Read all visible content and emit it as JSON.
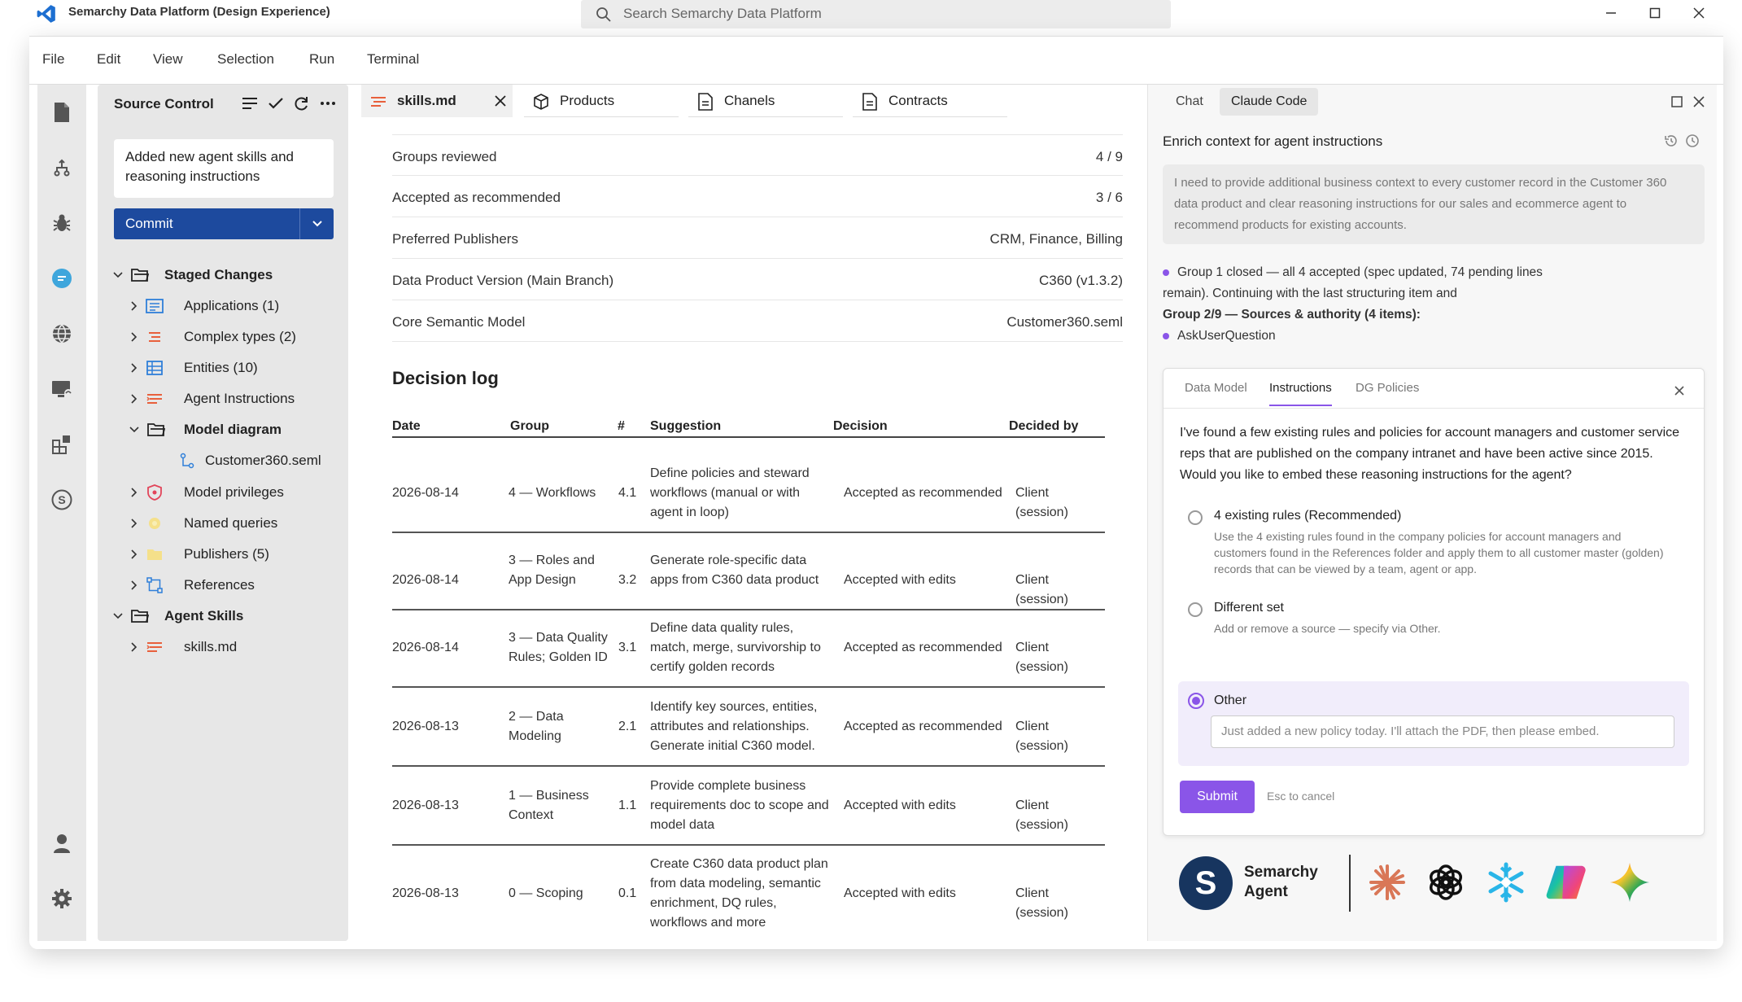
{
  "window": {
    "title": "Semarchy Data Platform (Design Experience)",
    "search_placeholder": "Search Semarchy Data Platform"
  },
  "menu": [
    "File",
    "Edit",
    "View",
    "Selection",
    "Run",
    "Terminal"
  ],
  "activity_icons": [
    "file-icon",
    "source-control-icon",
    "bug-icon",
    "chat-icon",
    "globe-icon",
    "remote-icon",
    "extensions-icon",
    "semarchy-icon",
    "account-icon",
    "settings-icon"
  ],
  "source_control": {
    "title": "Source Control",
    "commit_message": "Added new agent skills and reasoning instructions",
    "commit_label": "Commit",
    "tree": [
      {
        "label": "Staged Changes",
        "bold": true
      },
      {
        "label": "Applications (1)"
      },
      {
        "label": "Complex types (2)"
      },
      {
        "label": "Entities (10)"
      },
      {
        "label": "Agent Instructions"
      },
      {
        "label": "Model diagram",
        "bold": true
      },
      {
        "label": "Customer360.seml"
      },
      {
        "label": "Model privileges"
      },
      {
        "label": "Named queries"
      },
      {
        "label": "Publishers (5)"
      },
      {
        "label": "References"
      },
      {
        "label": "Agent Skills",
        "bold": true
      },
      {
        "label": "skills.md"
      }
    ]
  },
  "tabs": [
    {
      "label": "skills.md",
      "active": true
    },
    {
      "label": "Products"
    },
    {
      "label": "Chanels"
    },
    {
      "label": "Contracts"
    }
  ],
  "summary": [
    {
      "key": "Groups reviewed",
      "value": "4 / 9"
    },
    {
      "key": "Accepted as recommended",
      "value": "3 / 6"
    },
    {
      "key": "Preferred Publishers",
      "value": "CRM, Finance, Billing"
    },
    {
      "key": "Data Product Version (Main Branch)",
      "value": "C360 (v1.3.2)"
    },
    {
      "key": "Core Semantic Model",
      "value": "Customer360.seml"
    }
  ],
  "decision_log": {
    "title": "Decision log",
    "columns": [
      "Date",
      "Group",
      "#",
      "Suggestion",
      "Decision",
      "Decided by"
    ],
    "rows": [
      {
        "date": "2026-08-14",
        "group": "4 — Workflows",
        "num": "4.1",
        "suggestion": "Define policies and steward workflows (manual or with agent in loop)",
        "decision": "Accepted as recommended",
        "by": "Client (session)"
      },
      {
        "date": "2026-08-14",
        "group": "3 — Roles and App Design",
        "num": "3.2",
        "suggestion": "Generate role-specific data apps from C360 data product",
        "decision": "Accepted with edits",
        "by": "Client (session)"
      },
      {
        "date": "2026-08-14",
        "group": "3 — Data Quality Rules; Golden ID",
        "num": "3.1",
        "suggestion": "Define data quality rules, match, merge, survivorship to certify golden records",
        "decision": "Accepted as recommended",
        "by": "Client (session)"
      },
      {
        "date": "2026-08-13",
        "group": "2 — Data Modeling",
        "num": "2.1",
        "suggestion": "Identify key sources, entities, attributes and relationships. Generate initial C360 model.",
        "decision": "Accepted as recommended",
        "by": "Client (session)"
      },
      {
        "date": "2026-08-13",
        "group": "1 — Business Context",
        "num": "1.1",
        "suggestion": "Provide complete business requirements doc to scope and model data",
        "decision": "Accepted with edits",
        "by": "Client (session)"
      },
      {
        "date": "2026-08-13",
        "group": "0 — Scoping",
        "num": "0.1",
        "suggestion": "Create C360 data product plan from data modeling, semantic enrichment, DQ rules, workflows and more",
        "decision": "Accepted with edits",
        "by": "Client (session)"
      }
    ]
  },
  "chat_panel": {
    "tabs": [
      "Chat",
      "Claude Code"
    ],
    "title": "Enrich context for agent instructions",
    "prompt": "I need to provide additional business context to every customer record in the Customer 360 data product and clear reasoning instructions for our sales and ecommerce agent to recommend products for existing accounts.",
    "status_1": "Group 1 closed — all 4 accepted (spec updated, 74 pending lines remain). Continuing with the last structuring item and",
    "status_1b": "Group 2/9 — Sources & authority (4 items):",
    "status_2": "AskUserQuestion",
    "question": {
      "tabs": [
        "Data Model",
        "Instructions",
        "DG Policies"
      ],
      "text": "I've found a few existing rules and policies for account managers and customer service reps that are published on the company intranet and have been active since 2015. Would you like to embed these reasoning instructions for the agent?",
      "options": [
        {
          "label": "4 existing rules (Recommended)",
          "desc": "Use the 4 existing rules found in the company policies for account managers and customers found in the References folder and apply them to all customer master (golden) records that can be viewed by a team, agent or app."
        },
        {
          "label": "Different set",
          "desc": "Add or remove a source — specify via Other."
        }
      ],
      "other_label": "Other",
      "other_value": "Just added a new policy today. I'll attach the PDF, then please embed.",
      "submit": "Submit",
      "cancel_hint": "Esc to cancel"
    },
    "brand": {
      "name": "Semarchy Agent",
      "logo_letter": "S"
    },
    "ai_logos": [
      "claude-icon",
      "openai-icon",
      "snowflake-icon",
      "copilot-icon",
      "gemini-icon"
    ]
  },
  "colors": {
    "accent": "#8a55e8",
    "commit": "#1d4a9e",
    "brand_navy": "#17355f"
  }
}
